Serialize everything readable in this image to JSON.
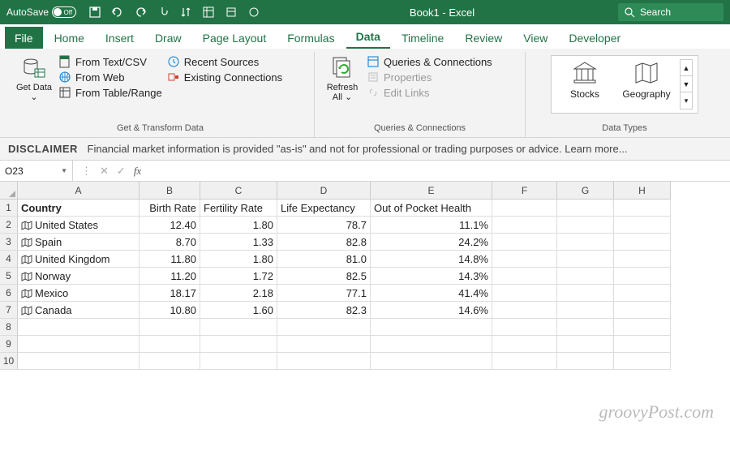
{
  "titlebar": {
    "autosave_label": "AutoSave",
    "autosave_state": "Off",
    "doc_title": "Book1 - Excel",
    "search_placeholder": "Search"
  },
  "tabs": {
    "file": "File",
    "home": "Home",
    "insert": "Insert",
    "draw": "Draw",
    "page_layout": "Page Layout",
    "formulas": "Formulas",
    "data": "Data",
    "timeline": "Timeline",
    "review": "Review",
    "view": "View",
    "developer": "Developer"
  },
  "ribbon": {
    "get_data": "Get Data",
    "from_text_csv": "From Text/CSV",
    "from_web": "From Web",
    "from_table_range": "From Table/Range",
    "recent_sources": "Recent Sources",
    "existing_connections": "Existing Connections",
    "group_transform": "Get & Transform Data",
    "refresh_all": "Refresh All",
    "queries_connections": "Queries & Connections",
    "properties": "Properties",
    "edit_links": "Edit Links",
    "group_queries": "Queries & Connections",
    "stocks": "Stocks",
    "geography": "Geography",
    "group_datatypes": "Data Types"
  },
  "disclaimer": {
    "heading": "DISCLAIMER",
    "text": "Financial market information is provided \"as-is\" and not for professional or trading purposes or advice. Learn more..."
  },
  "namebox": {
    "value": "O23",
    "fx": "fx"
  },
  "columns": [
    "A",
    "B",
    "C",
    "D",
    "E",
    "F",
    "G",
    "H"
  ],
  "row_numbers": [
    "1",
    "2",
    "3",
    "4",
    "5",
    "6",
    "7",
    "8",
    "9",
    "10"
  ],
  "headers": {
    "country": "Country",
    "birth_rate": "Birth Rate",
    "fertility_rate": "Fertility Rate",
    "life_expectancy": "Life Expectancy",
    "out_of_pocket": "Out of Pocket Health"
  },
  "rows": [
    {
      "country": "United States",
      "birth_rate": "12.40",
      "fertility": "1.80",
      "life": "78.7",
      "oop": "11.1%"
    },
    {
      "country": "Spain",
      "birth_rate": "8.70",
      "fertility": "1.33",
      "life": "82.8",
      "oop": "24.2%"
    },
    {
      "country": "United Kingdom",
      "birth_rate": "11.80",
      "fertility": "1.80",
      "life": "81.0",
      "oop": "14.8%"
    },
    {
      "country": "Norway",
      "birth_rate": "11.20",
      "fertility": "1.72",
      "life": "82.5",
      "oop": "14.3%"
    },
    {
      "country": "Mexico",
      "birth_rate": "18.17",
      "fertility": "2.18",
      "life": "77.1",
      "oop": "41.4%"
    },
    {
      "country": "Canada",
      "birth_rate": "10.80",
      "fertility": "1.60",
      "life": "82.3",
      "oop": "14.6%"
    }
  ],
  "watermark": "groovyPost.com"
}
